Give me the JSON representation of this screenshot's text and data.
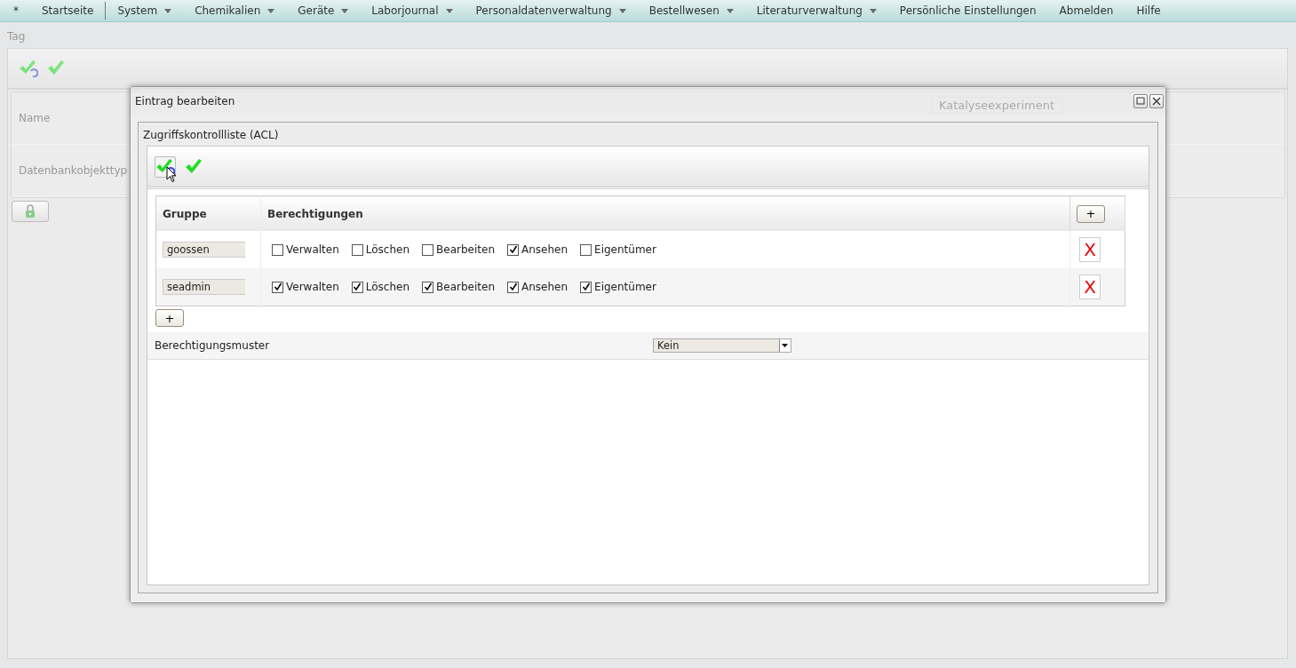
{
  "menu": [
    {
      "label": "*",
      "dropdown": false,
      "separator_after": false
    },
    {
      "label": "Startseite",
      "dropdown": false,
      "separator_after": true
    },
    {
      "label": "System",
      "dropdown": true,
      "separator_after": false
    },
    {
      "label": "Chemikalien",
      "dropdown": true,
      "separator_after": false
    },
    {
      "label": "Geräte",
      "dropdown": true,
      "separator_after": false
    },
    {
      "label": "Laborjournal",
      "dropdown": true,
      "separator_after": false
    },
    {
      "label": "Personaldatenverwaltung",
      "dropdown": true,
      "separator_after": false
    },
    {
      "label": "Bestellwesen",
      "dropdown": true,
      "separator_after": false
    },
    {
      "label": "Literaturverwaltung",
      "dropdown": true,
      "separator_after": false
    },
    {
      "label": "Persönliche Einstellungen",
      "dropdown": false,
      "separator_after": false
    },
    {
      "label": "Abmelden",
      "dropdown": false,
      "separator_after": false
    },
    {
      "label": "Hilfe",
      "dropdown": false,
      "separator_after": false
    }
  ],
  "page": {
    "title": "Tag",
    "fields": [
      {
        "label": "Name",
        "value": "Katalyseexperiment"
      },
      {
        "label": "Datenbankobjekttyp"
      }
    ]
  },
  "dialog": {
    "title": "Eintrag bearbeiten",
    "section": "Zugriffskontrollliste (ACL)",
    "columns": [
      "Gruppe",
      "Berechtigungen"
    ],
    "header_add_label": "+",
    "bottom_add_label": "+",
    "rows": [
      {
        "group": "goossen",
        "delete_label": "X",
        "permissions": [
          {
            "label": "Verwalten",
            "checked": false
          },
          {
            "label": "Löschen",
            "checked": false
          },
          {
            "label": "Bearbeiten",
            "checked": false
          },
          {
            "label": "Ansehen",
            "checked": true
          },
          {
            "label": "Eigentümer",
            "checked": false
          }
        ]
      },
      {
        "group": "seadmin",
        "delete_label": "X",
        "permissions": [
          {
            "label": "Verwalten",
            "checked": true
          },
          {
            "label": "Löschen",
            "checked": true
          },
          {
            "label": "Bearbeiten",
            "checked": true
          },
          {
            "label": "Ansehen",
            "checked": true
          },
          {
            "label": "Eigentümer",
            "checked": true
          }
        ]
      }
    ],
    "pattern": {
      "label": "Berechtigungsmuster",
      "value": "Kein"
    }
  }
}
